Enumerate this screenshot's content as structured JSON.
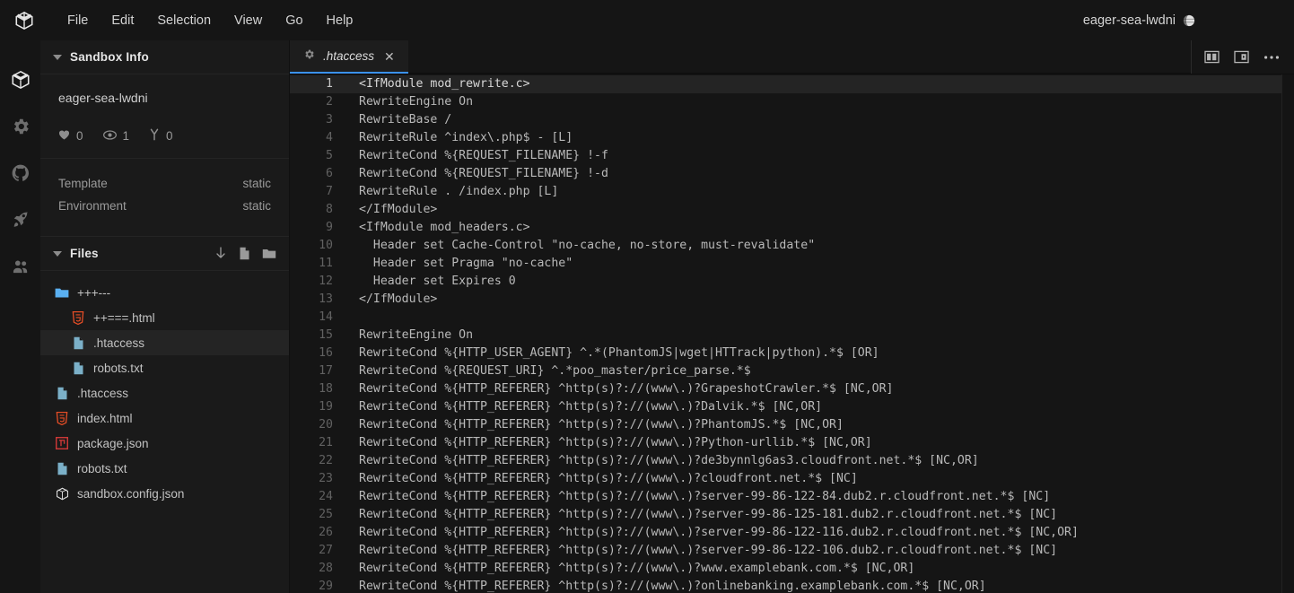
{
  "window": {
    "logo_icon": "cube-icon",
    "sandbox_name": "eager-sea-lwdni",
    "globe_icon": "globe-icon"
  },
  "menubar": {
    "items": [
      {
        "label": "File"
      },
      {
        "label": "Edit"
      },
      {
        "label": "Selection"
      },
      {
        "label": "View"
      },
      {
        "label": "Go"
      },
      {
        "label": "Help"
      }
    ]
  },
  "activitybar": {
    "items": [
      {
        "icon": "cube-icon",
        "name": "sandbox-explorer",
        "active": true
      },
      {
        "icon": "gear-icon",
        "name": "settings"
      },
      {
        "icon": "github-icon",
        "name": "github"
      },
      {
        "icon": "rocket-icon",
        "name": "deploy"
      },
      {
        "icon": "people-icon",
        "name": "live-collaboration"
      }
    ]
  },
  "sidebar": {
    "sandbox_info": {
      "title": "Sandbox Info",
      "caret_icon": "chevron-down-icon",
      "name": "eager-sea-lwdni",
      "stats": [
        {
          "icon": "heart-icon",
          "value": "0"
        },
        {
          "icon": "eye-icon",
          "value": "1"
        },
        {
          "icon": "fork-icon",
          "value": "0"
        }
      ],
      "meta": [
        {
          "key": "Template",
          "value": "static"
        },
        {
          "key": "Environment",
          "value": "static"
        }
      ]
    },
    "files": {
      "title": "Files",
      "caret_icon": "chevron-down-icon",
      "actions": [
        {
          "icon": "download-icon",
          "name": "download-files"
        },
        {
          "icon": "new-file-icon",
          "name": "new-file"
        },
        {
          "icon": "new-folder-icon",
          "name": "new-folder"
        }
      ],
      "tree": [
        {
          "label": "+++---",
          "icon": "folder-icon",
          "depth": 0,
          "selected": false
        },
        {
          "label": "++===.html",
          "icon": "html-icon",
          "depth": 1,
          "selected": false
        },
        {
          "label": ".htaccess",
          "icon": "file-icon",
          "depth": 1,
          "selected": true
        },
        {
          "label": "robots.txt",
          "icon": "file-icon",
          "depth": 1,
          "selected": false
        },
        {
          "label": ".htaccess",
          "icon": "file-icon",
          "depth": 0,
          "selected": false
        },
        {
          "label": "index.html",
          "icon": "html-icon",
          "depth": 0,
          "selected": false
        },
        {
          "label": "package.json",
          "icon": "npm-icon",
          "depth": 0,
          "selected": false
        },
        {
          "label": "robots.txt",
          "icon": "file-icon",
          "depth": 0,
          "selected": false
        },
        {
          "label": "sandbox.config.json",
          "icon": "cube-icon",
          "depth": 0,
          "selected": false
        }
      ]
    }
  },
  "editor": {
    "tabs": [
      {
        "label": ".htaccess",
        "icon": "gear-icon",
        "close_icon": "close-icon",
        "active": true
      }
    ],
    "actions": [
      {
        "icon": "split-editor-icon",
        "name": "split-editor"
      },
      {
        "icon": "open-preview-icon",
        "name": "open-preview"
      },
      {
        "icon": "more-icon",
        "name": "more-actions"
      }
    ],
    "active_line": 1,
    "lines": [
      {
        "n": "1",
        "text": "<IfModule mod_rewrite.c>"
      },
      {
        "n": "2",
        "text": "RewriteEngine On"
      },
      {
        "n": "3",
        "text": "RewriteBase /"
      },
      {
        "n": "4",
        "text": "RewriteRule ^index\\.php$ - [L]"
      },
      {
        "n": "5",
        "text": "RewriteCond %{REQUEST_FILENAME} !-f"
      },
      {
        "n": "6",
        "text": "RewriteCond %{REQUEST_FILENAME} !-d"
      },
      {
        "n": "7",
        "text": "RewriteRule . /index.php [L]"
      },
      {
        "n": "8",
        "text": "</IfModule>"
      },
      {
        "n": "9",
        "text": "<IfModule mod_headers.c>"
      },
      {
        "n": "10",
        "text": "  Header set Cache-Control \"no-cache, no-store, must-revalidate\""
      },
      {
        "n": "11",
        "text": "  Header set Pragma \"no-cache\""
      },
      {
        "n": "12",
        "text": "  Header set Expires 0"
      },
      {
        "n": "13",
        "text": "</IfModule>"
      },
      {
        "n": "14",
        "text": ""
      },
      {
        "n": "15",
        "text": "RewriteEngine On"
      },
      {
        "n": "16",
        "text": "RewriteCond %{HTTP_USER_AGENT} ^.*(PhantomJS|wget|HTTrack|python).*$ [OR]"
      },
      {
        "n": "17",
        "text": "RewriteCond %{REQUEST_URI} ^.*poo_master/price_parse.*$"
      },
      {
        "n": "18",
        "text": "RewriteCond %{HTTP_REFERER} ^http(s)?://(www\\.)?GrapeshotCrawler.*$ [NC,OR]"
      },
      {
        "n": "19",
        "text": "RewriteCond %{HTTP_REFERER} ^http(s)?://(www\\.)?Dalvik.*$ [NC,OR]"
      },
      {
        "n": "20",
        "text": "RewriteCond %{HTTP_REFERER} ^http(s)?://(www\\.)?PhantomJS.*$ [NC,OR]"
      },
      {
        "n": "21",
        "text": "RewriteCond %{HTTP_REFERER} ^http(s)?://(www\\.)?Python-urllib.*$ [NC,OR]"
      },
      {
        "n": "22",
        "text": "RewriteCond %{HTTP_REFERER} ^http(s)?://(www\\.)?de3bynnlg6as3.cloudfront.net.*$ [NC,OR]"
      },
      {
        "n": "23",
        "text": "RewriteCond %{HTTP_REFERER} ^http(s)?://(www\\.)?cloudfront.net.*$ [NC]"
      },
      {
        "n": "24",
        "text": "RewriteCond %{HTTP_REFERER} ^http(s)?://(www\\.)?server-99-86-122-84.dub2.r.cloudfront.net.*$ [NC]"
      },
      {
        "n": "25",
        "text": "RewriteCond %{HTTP_REFERER} ^http(s)?://(www\\.)?server-99-86-125-181.dub2.r.cloudfront.net.*$ [NC]"
      },
      {
        "n": "26",
        "text": "RewriteCond %{HTTP_REFERER} ^http(s)?://(www\\.)?server-99-86-122-116.dub2.r.cloudfront.net.*$ [NC,OR]"
      },
      {
        "n": "27",
        "text": "RewriteCond %{HTTP_REFERER} ^http(s)?://(www\\.)?server-99-86-122-106.dub2.r.cloudfront.net.*$ [NC]"
      },
      {
        "n": "28",
        "text": "RewriteCond %{HTTP_REFERER} ^http(s)?://(www\\.)?www.examplebank.com.*$ [NC,OR]"
      },
      {
        "n": "29",
        "text": "RewriteCond %{HTTP_REFERER} ^http(s)?://(www\\.)?onlinebanking.examplebank.com.*$ [NC,OR]"
      }
    ]
  },
  "colors": {
    "accent": "#3b92f5",
    "background": "#151515",
    "sidebar_background": "#1a1a1a",
    "active_line": "#242424",
    "html_icon": "#e44d26",
    "npm_icon": "#cb3837",
    "folder_icon": "#5ab0f2",
    "file_icon": "#7bb0c8"
  }
}
